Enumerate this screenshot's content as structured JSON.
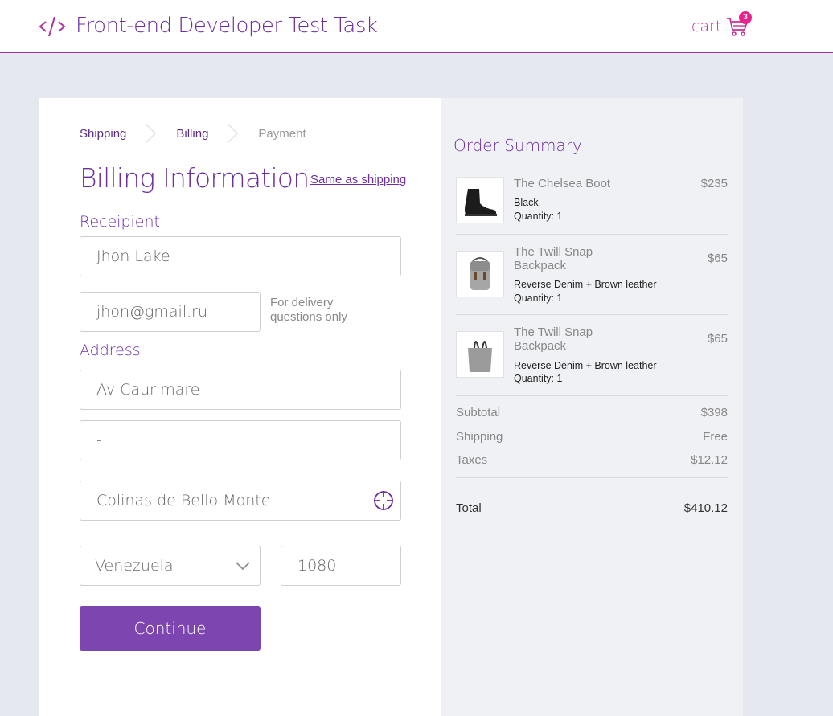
{
  "header": {
    "title": "Front-end Developer Test Task",
    "cart_label": "cart",
    "cart_count": "3"
  },
  "breadcrumb": {
    "steps": [
      "Shipping",
      "Billing",
      "Payment"
    ]
  },
  "form": {
    "title": "Billing Information",
    "same_as_shipping": "Same as shipping",
    "recipient_label": "Receipient",
    "name_value": "Jhon Lake",
    "email_value": "jhon@gmail.ru",
    "email_hint": "For delivery questions only",
    "address_label": "Address",
    "street_value": "Av Caurimare",
    "street2_value": "-",
    "city_value": "Colinas de Bello Monte",
    "country_value": "Venezuela",
    "zip_value": "1080",
    "continue_label": "Continue"
  },
  "summary": {
    "title": "Order Summary",
    "items": [
      {
        "name": "The Chelsea Boot",
        "price": "$235",
        "variant": "Black",
        "quantity": "Quantity: 1",
        "icon": "boot-image"
      },
      {
        "name": "The Twill Snap Backpack",
        "price": "$65",
        "variant": "Reverse Denim + Brown leather",
        "quantity": "Quantity: 1",
        "icon": "backpack-image"
      },
      {
        "name": "The Twill Snap Backpack",
        "price": "$65",
        "variant": "Reverse Denim + Brown leather",
        "quantity": "Quantity: 1",
        "icon": "tote-image"
      }
    ],
    "subtotal_label": "Subtotal",
    "subtotal_value": "$398",
    "shipping_label": "Shipping",
    "shipping_value": "Free",
    "taxes_label": "Taxes",
    "taxes_value": "$12.12",
    "total_label": "Total",
    "total_value": "$410.12"
  },
  "colors": {
    "brand_purple": "#6b2fa0",
    "button_purple": "#7d45b0",
    "badge_pink": "#e9238b",
    "cart_pink": "#c0339a",
    "background": "#e6e8f0"
  }
}
